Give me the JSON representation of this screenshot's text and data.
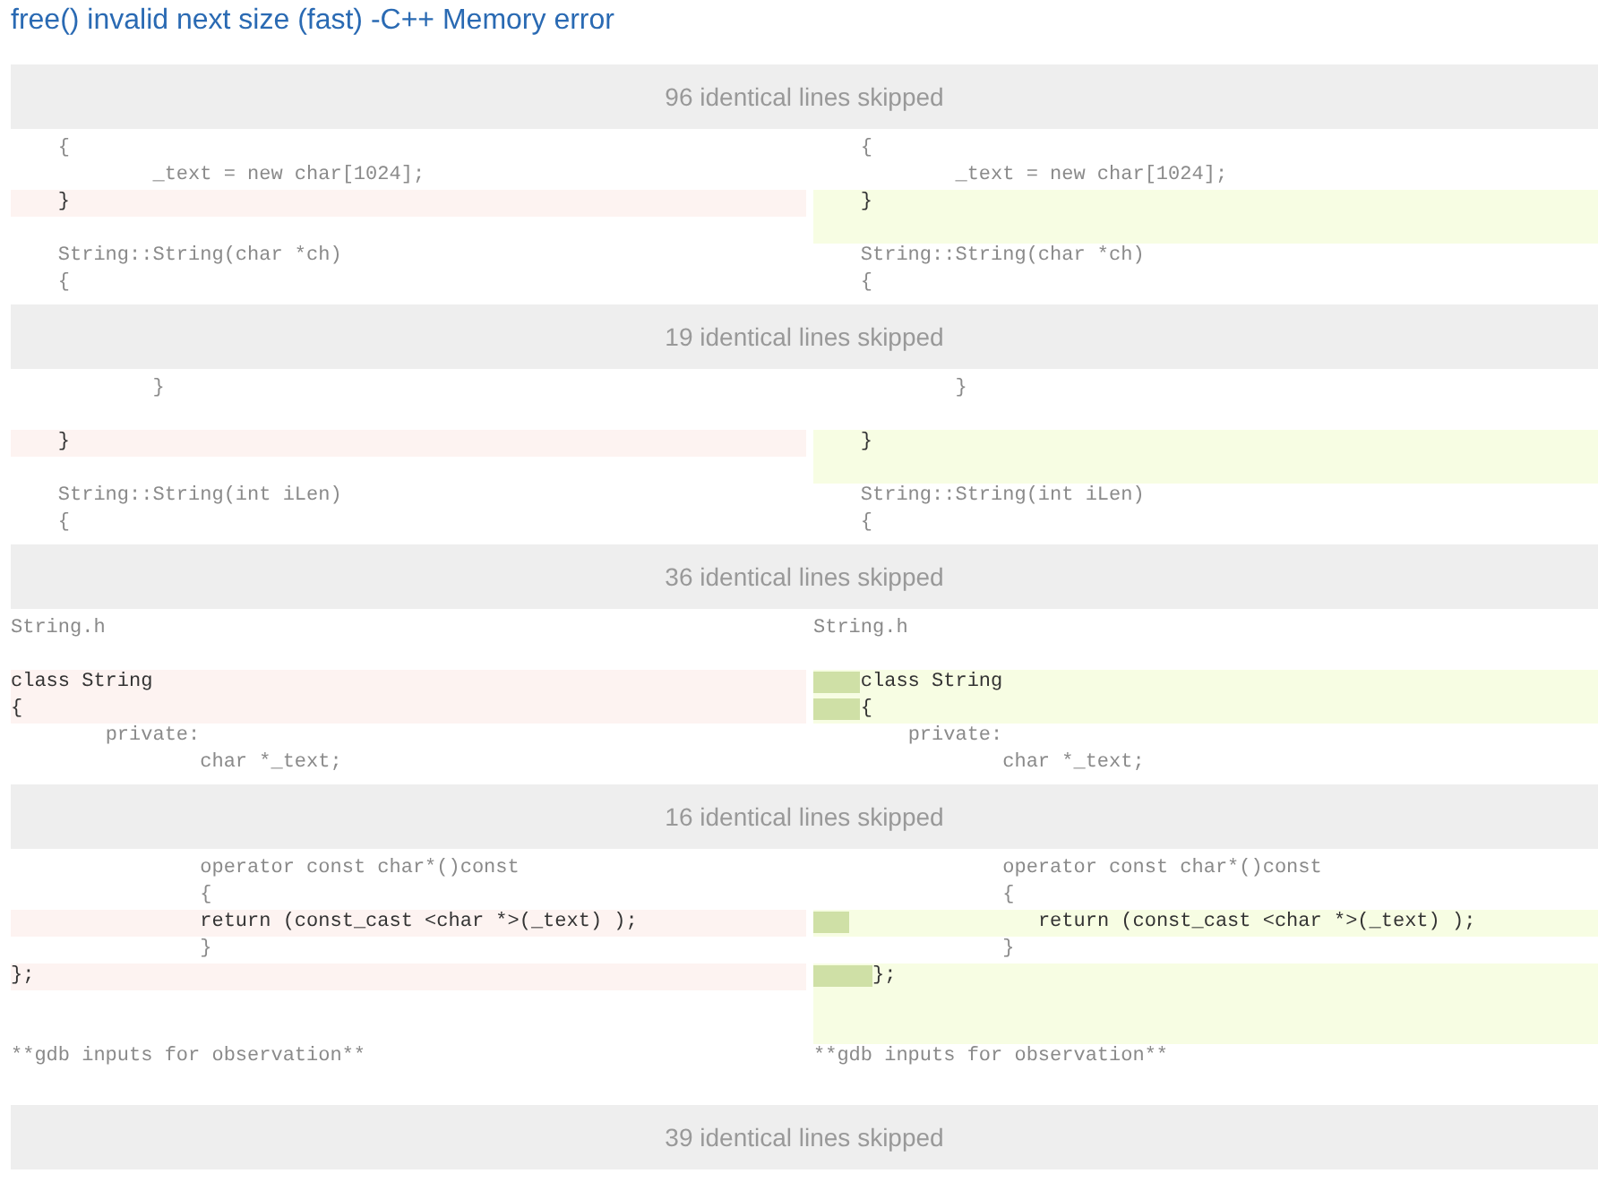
{
  "title": "free() invalid next size (fast) -C++ Memory error",
  "rows": [
    {
      "kind": "skip",
      "text": "96 identical lines skipped"
    },
    {
      "kind": "line",
      "left": {
        "text": "    {",
        "kind": "same"
      },
      "right": {
        "text": "    {",
        "kind": "same"
      }
    },
    {
      "kind": "line",
      "left": {
        "text": "            _text = new char[1024];",
        "kind": "same"
      },
      "right": {
        "text": "            _text = new char[1024];",
        "kind": "same"
      }
    },
    {
      "kind": "line",
      "left": {
        "text": "    }",
        "kind": "removed"
      },
      "right": {
        "text": "    }",
        "kind": "added"
      }
    },
    {
      "kind": "line",
      "left": {
        "kind": "same"
      },
      "right": {
        "kind": "added"
      }
    },
    {
      "kind": "line",
      "left": {
        "text": "    String::String(char *ch)",
        "kind": "same"
      },
      "right": {
        "text": "    String::String(char *ch)",
        "kind": "same"
      }
    },
    {
      "kind": "line",
      "left": {
        "text": "    {",
        "kind": "same"
      },
      "right": {
        "text": "    {",
        "kind": "same"
      }
    },
    {
      "kind": "skip",
      "text": "19 identical lines skipped"
    },
    {
      "kind": "line",
      "left": {
        "text": "            }",
        "kind": "same"
      },
      "right": {
        "text": "            }",
        "kind": "same"
      }
    },
    {
      "kind": "line",
      "left": {
        "kind": "same"
      },
      "right": {
        "kind": "same"
      }
    },
    {
      "kind": "line",
      "left": {
        "text": "    }",
        "kind": "removed"
      },
      "right": {
        "text": "    }",
        "kind": "added"
      }
    },
    {
      "kind": "line",
      "left": {
        "kind": "same"
      },
      "right": {
        "kind": "added"
      }
    },
    {
      "kind": "line",
      "left": {
        "text": "    String::String(int iLen)",
        "kind": "same"
      },
      "right": {
        "text": "    String::String(int iLen)",
        "kind": "same"
      }
    },
    {
      "kind": "line",
      "left": {
        "text": "    {",
        "kind": "same"
      },
      "right": {
        "text": "    {",
        "kind": "same"
      }
    },
    {
      "kind": "skip",
      "text": "36 identical lines skipped"
    },
    {
      "kind": "line",
      "left": {
        "text": "String.h",
        "kind": "same"
      },
      "right": {
        "text": "String.h",
        "kind": "same"
      }
    },
    {
      "kind": "line",
      "left": {
        "kind": "same"
      },
      "right": {
        "kind": "same"
      }
    },
    {
      "kind": "line",
      "left": {
        "text": "class String",
        "kind": "removed"
      },
      "right": {
        "indent_changed": true,
        "text": "    class String",
        "kind": "added"
      }
    },
    {
      "kind": "line",
      "left": {
        "text": "{",
        "kind": "removed"
      },
      "right": {
        "indent_changed": true,
        "text": "    {",
        "kind": "added"
      }
    },
    {
      "kind": "line",
      "left": {
        "text": "        private:",
        "kind": "same"
      },
      "right": {
        "text": "        private:",
        "kind": "same"
      }
    },
    {
      "kind": "line",
      "left": {
        "text": "                char *_text;",
        "kind": "same"
      },
      "right": {
        "text": "                char *_text;",
        "kind": "same"
      }
    },
    {
      "kind": "skip",
      "text": "16 identical lines skipped"
    },
    {
      "kind": "line",
      "left": {
        "text": "                operator const char*()const",
        "kind": "same"
      },
      "right": {
        "text": "                operator const char*()const",
        "kind": "same"
      }
    },
    {
      "kind": "line",
      "left": {
        "text": "                {",
        "kind": "same"
      },
      "right": {
        "text": "                {",
        "kind": "same"
      }
    },
    {
      "kind": "line",
      "left": {
        "text": "                return (const_cast <char *>(_text) );",
        "kind": "removed"
      },
      "right": {
        "indent_changed": true,
        "text": "                   return (const_cast <char *>(_text) );",
        "kind": "added"
      }
    },
    {
      "kind": "line",
      "left": {
        "text": "                }",
        "kind": "same"
      },
      "right": {
        "text": "                }",
        "kind": "same"
      }
    },
    {
      "kind": "line",
      "left": {
        "text": "};",
        "kind": "removed"
      },
      "right": {
        "indent_changed": true,
        "text": "     };",
        "kind": "added"
      }
    },
    {
      "kind": "line",
      "left": {
        "kind": "same"
      },
      "right": {
        "kind": "added"
      }
    },
    {
      "kind": "line",
      "left": {
        "kind": "same"
      },
      "right": {
        "kind": "added"
      }
    },
    {
      "kind": "line",
      "left": {
        "text": "**gdb inputs for observation**",
        "kind": "same"
      },
      "right": {
        "text": "**gdb inputs for observation**",
        "kind": "same"
      }
    },
    {
      "kind": "line",
      "left": {
        "kind": "same"
      },
      "right": {
        "kind": "same"
      }
    },
    {
      "kind": "skip",
      "text": "39 identical lines skipped"
    }
  ]
}
